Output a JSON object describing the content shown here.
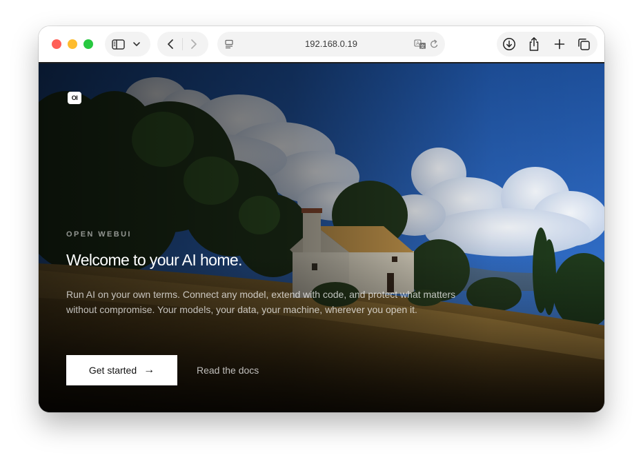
{
  "browser": {
    "url": "192.168.0.19",
    "icons": {
      "sidebar": "sidebar-icon",
      "sidebar_menu": "chevron-down-icon",
      "back": "chevron-left-icon",
      "forward": "chevron-right-icon",
      "page_menu": "page-menu-icon",
      "translate": "translate-icon",
      "reload": "reload-icon",
      "downloads": "download-icon",
      "share": "share-icon",
      "new_tab": "plus-icon",
      "tab_overview": "tabs-icon"
    },
    "traffic_colors": {
      "close": "#ff5f57",
      "minimize": "#febc2e",
      "zoom": "#28c840"
    }
  },
  "hero": {
    "logo_text": "OI",
    "eyebrow": "OPEN WEBUI",
    "headline": "Welcome to your AI home.",
    "description": "Run AI on your own terms. Connect any model, extend with code, and protect what matters without compromise. Your models, your data, your machine, wherever you open it.",
    "primary_button": "Get started",
    "primary_button_icon": "→",
    "secondary_link": "Read the docs"
  }
}
